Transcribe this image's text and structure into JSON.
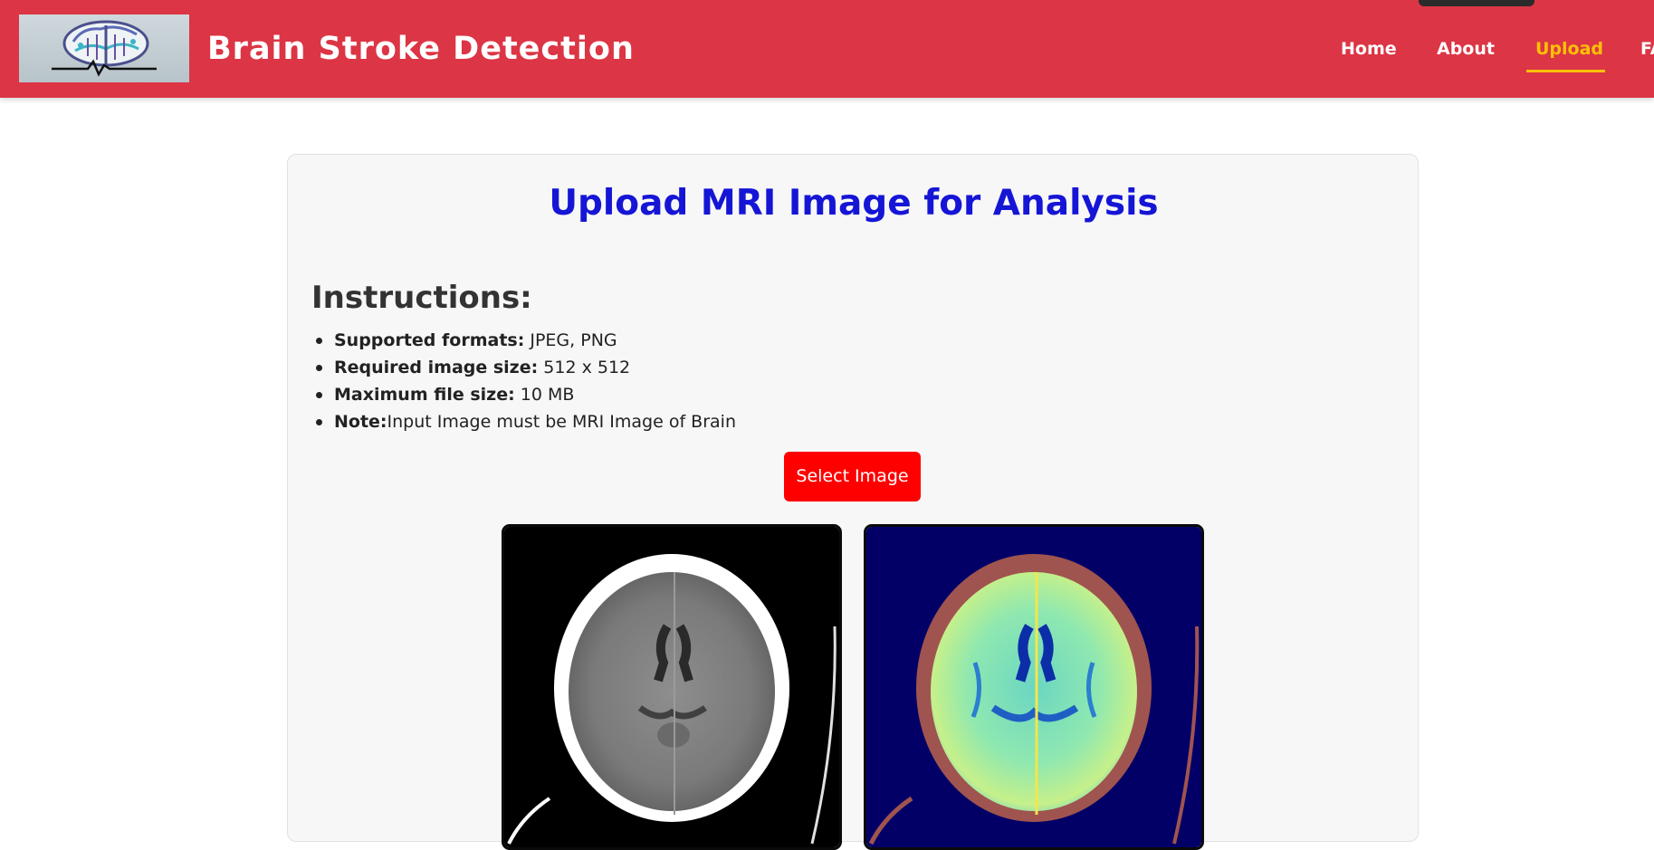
{
  "header": {
    "brand": "Brain Stroke Detection",
    "nav": [
      {
        "label": "Home",
        "active": false
      },
      {
        "label": "About",
        "active": false
      },
      {
        "label": "Upload",
        "active": true
      },
      {
        "label": "FAQ",
        "active": false
      }
    ],
    "colors": {
      "background": "#dc3545",
      "active_link": "#ffc107"
    }
  },
  "upload_card": {
    "title": "Upload MRI Image for Analysis",
    "instructions_heading": "Instructions:",
    "instructions": [
      {
        "label": "Supported formats:",
        "value": " JPEG, PNG"
      },
      {
        "label": "Required image size:",
        "value": " 512 x 512"
      },
      {
        "label": "Maximum file size:",
        "value": " 10 MB"
      },
      {
        "label": "Note:",
        "value": "Input Image must be MRI Image of Brain"
      }
    ],
    "select_button": "Select Image",
    "images": [
      {
        "kind": "original-ct-scan",
        "icon": "brain-scan-grayscale"
      },
      {
        "kind": "processed-heatmap",
        "icon": "brain-scan-colormap"
      }
    ],
    "colors": {
      "title": "#1515d6",
      "button": "#ff0000"
    }
  }
}
